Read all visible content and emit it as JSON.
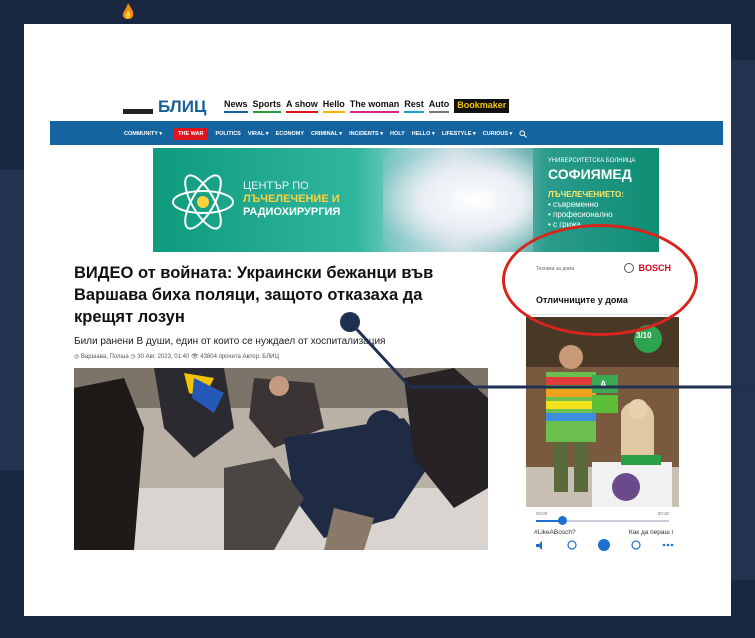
{
  "colors": {
    "frame": "#1a2740",
    "nav_blue": "#16649f",
    "war_red": "#e0141c",
    "bosch_red": "#e2001a",
    "annotation_red": "#d8241c",
    "pointer": "#1f3050"
  },
  "site": {
    "logo_text": "БЛИЦ",
    "top_nav": [
      "News",
      "Sports",
      "A show",
      "Hello",
      "The woman",
      "Rest",
      "Auto"
    ],
    "bookmaker": "Bookmaker",
    "main_nav": [
      {
        "label": "COMMUNITY ▾"
      },
      {
        "label": "THE WAR",
        "highlight": true
      },
      {
        "label": "POLITICS"
      },
      {
        "label": "VIRAL ▾"
      },
      {
        "label": "ECONOMY"
      },
      {
        "label": "CRIMINAL ▾"
      },
      {
        "label": "INCIDENTS ▾"
      },
      {
        "label": "HOLY"
      },
      {
        "label": "HELLO ▾"
      },
      {
        "label": "LIFESTYLE ▾"
      },
      {
        "label": "CURIOUS ▾"
      }
    ],
    "search_icon": "search-icon"
  },
  "banner_ad": {
    "line1": "ЦЕНТЪР ПО",
    "line2": "ЛЪЧЕЛЕЧЕНИЕ И",
    "line3": "РАДИОХИРУРГИЯ",
    "hospital_small": "УНИВЕРСИТЕТСКА БОЛНИЦА",
    "hospital_name": "СОФИЯМЕД",
    "tagline_title": "ЛЪЧЕЛЕЧЕНИЕТО:",
    "tagline_items": [
      "• съвременно",
      "• професионално",
      "• с грижа"
    ]
  },
  "article": {
    "headline": "ВИДЕО от войната: Украински бежанци във Варшава биха поляци, защото отказаха да крещят лозун",
    "subtitle": "Били ранени В души, един от които се нуждаел от хоспитализация",
    "meta": "◎ Варшава, Полша   ◷ 30 Авг. 2023, 01:40   👁 43804 прочита   Автор: БЛИЦ"
  },
  "side_ad": {
    "small_label": "Техника за дома",
    "brand": "BOSCH",
    "title": "Отличниците у дома",
    "badge_text": "3/10",
    "energy_class": "A",
    "time_start": "00:00",
    "time_end": "00:30",
    "progress": 0.2,
    "hashtag": "#LikeABosch?",
    "caption": "Как да пераш і",
    "controls": [
      "volume-icon",
      "rewind-icon",
      "play-icon",
      "forward-icon",
      "more-icon"
    ]
  }
}
